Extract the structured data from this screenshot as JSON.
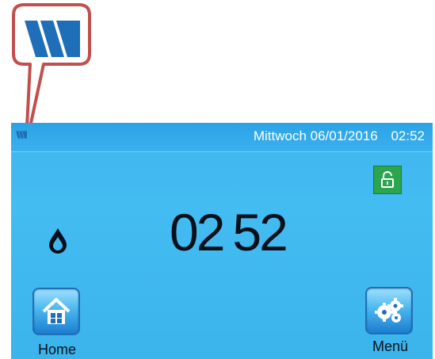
{
  "status_bar": {
    "date": "Mittwoch 06/01/2016",
    "time": "02:52"
  },
  "main": {
    "clock_hours": "02",
    "clock_minutes": "52"
  },
  "buttons": {
    "home_label": "Home",
    "menu_label": "Menü"
  },
  "icons": {
    "logo": "brand-logo-icon",
    "lock": "unlocked-padlock-icon",
    "drop": "water-drop-icon",
    "home": "home-icon",
    "menu": "gears-icon"
  },
  "colors": {
    "screen_background": "#3fb6ef",
    "callout_border": "#c0504d",
    "logo_blue": "#1f6fb8",
    "lock_green": "#2da44e"
  }
}
